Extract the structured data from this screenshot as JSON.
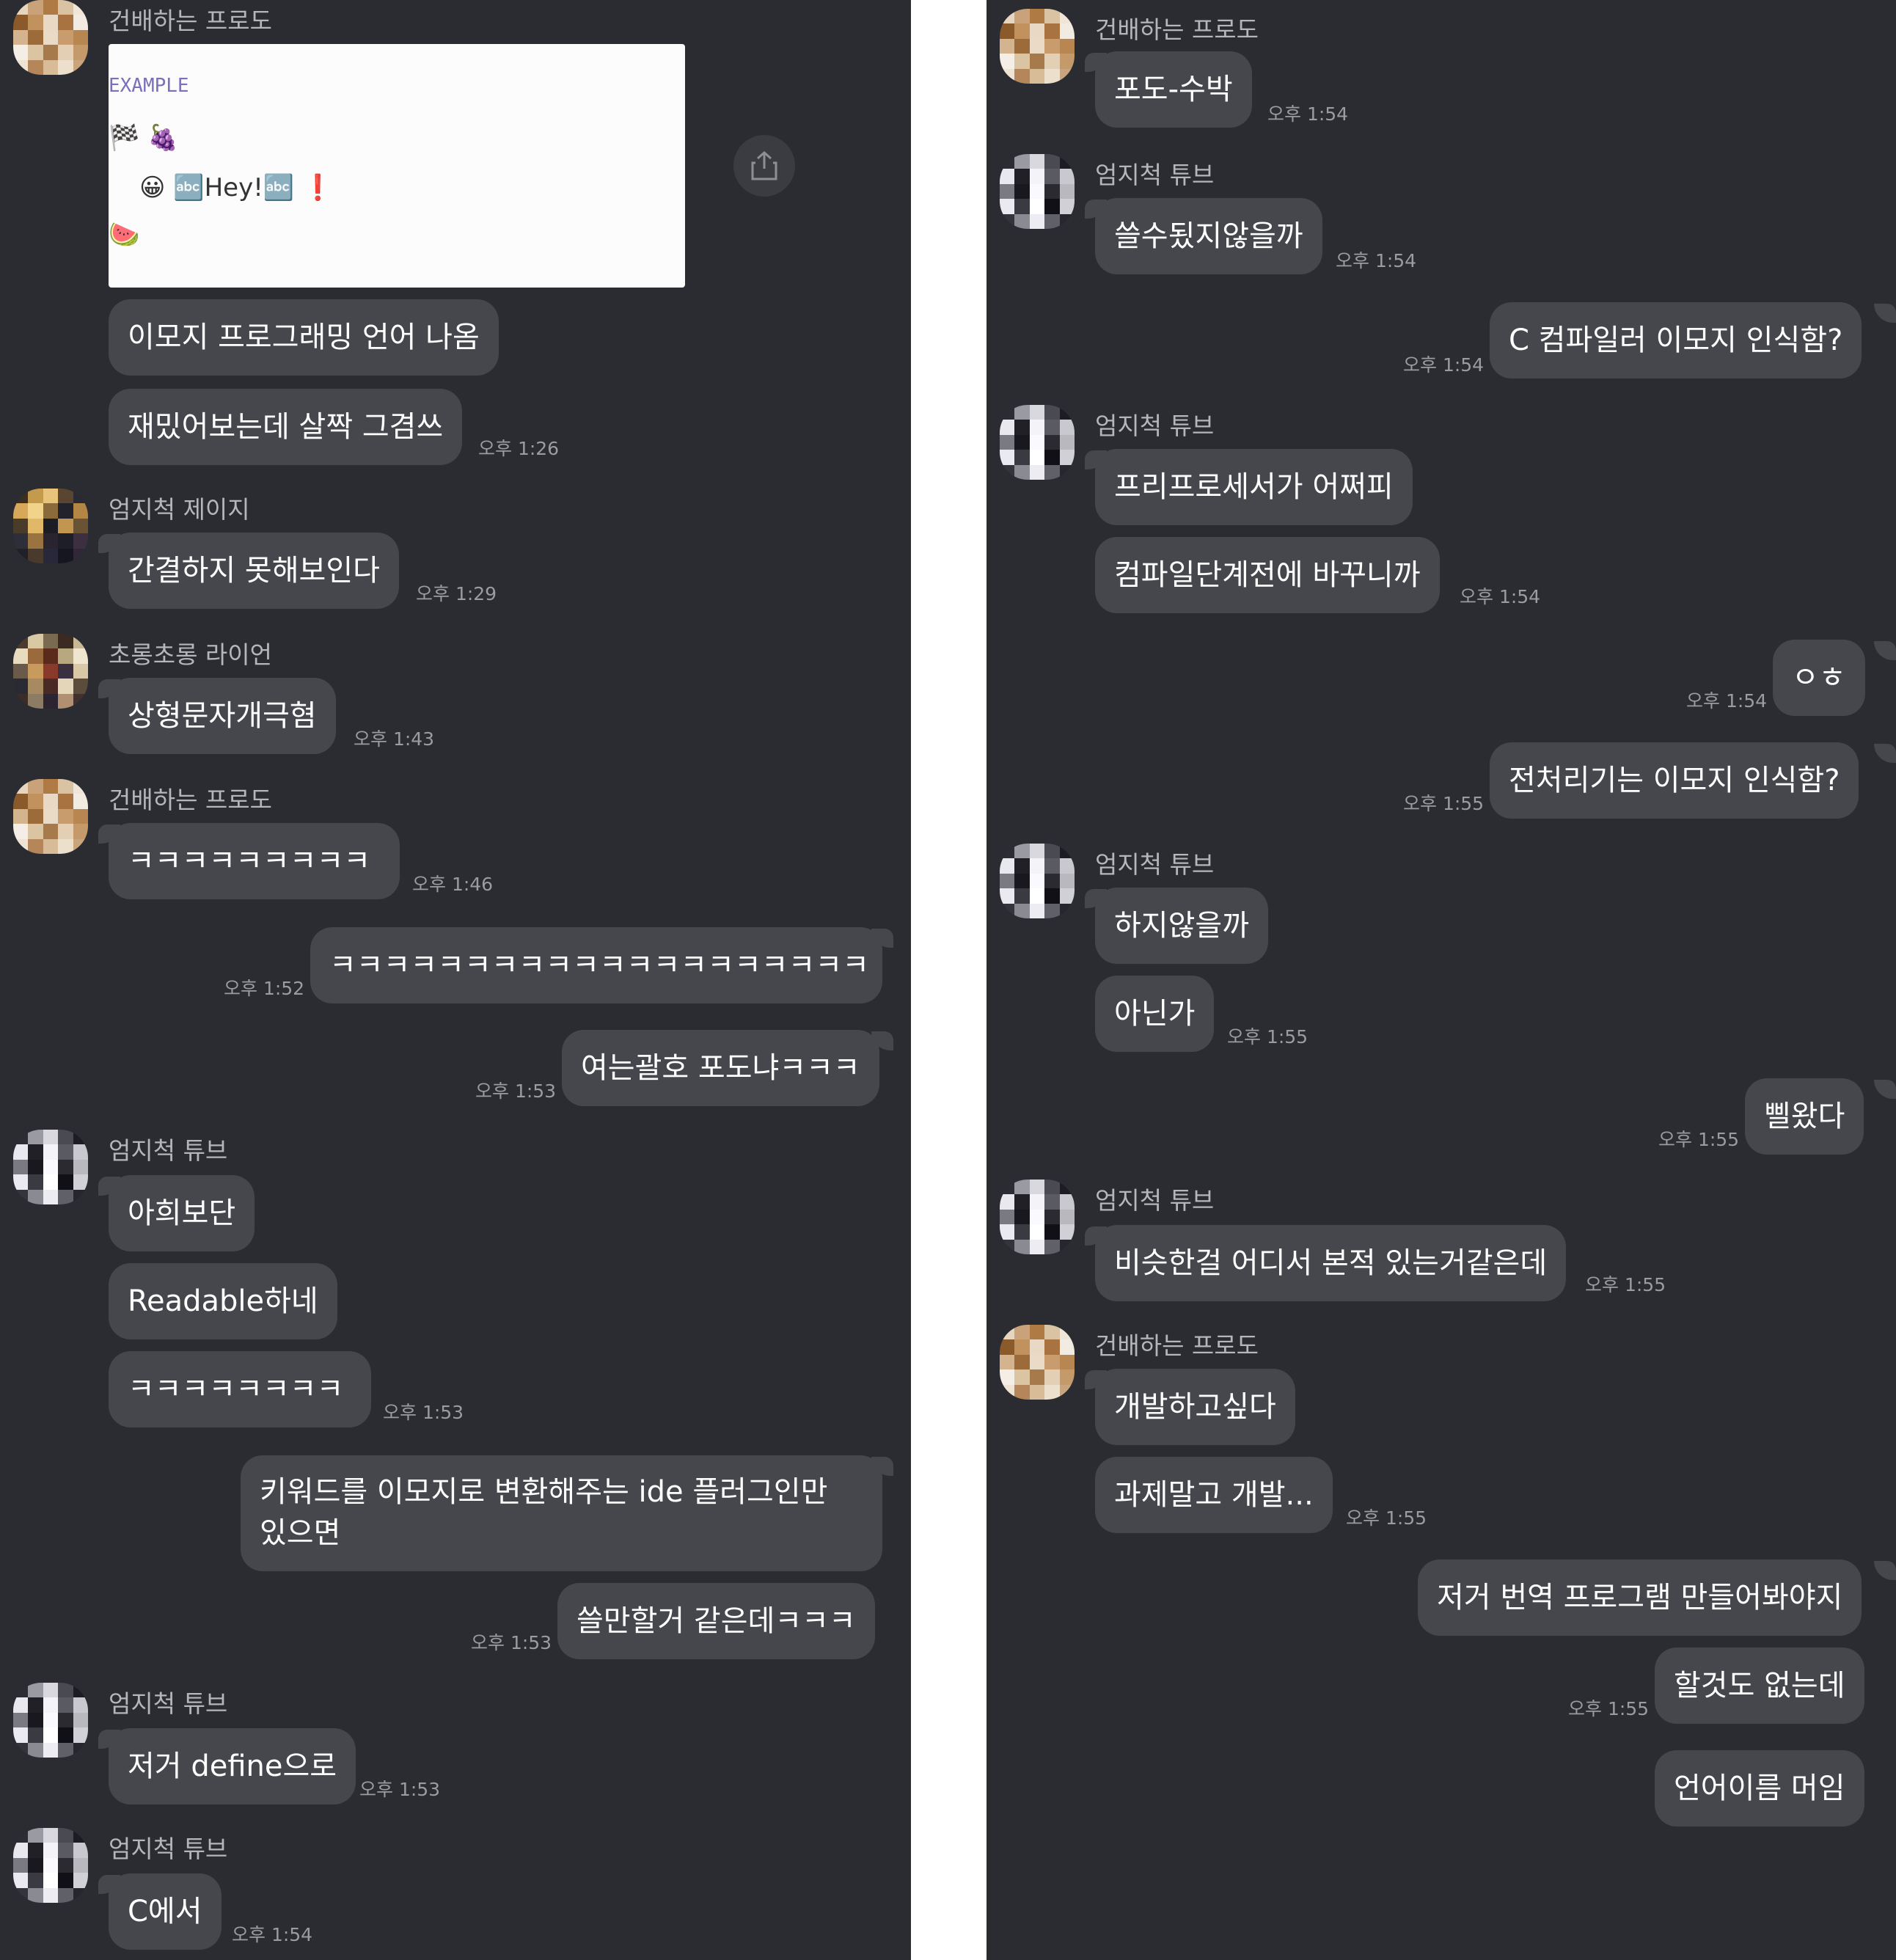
{
  "meta": {
    "ampm": "오후"
  },
  "left": {
    "card": {
      "lines": [
        "EXAMPLE",
        "🏁 🍇",
        "😀 🔤Hey!🔤 ❗",
        "🍉"
      ]
    },
    "messages": [
      {
        "sender": "건배하는 프로도",
        "bubbles": [
          "이모지 프로그래밍 언어 나옴",
          "재밌어보는데 살짝 그겸쓰"
        ],
        "time": "오후 1:26"
      },
      {
        "sender": "엄지척 제이지",
        "bubbles": [
          "간결하지 못해보인다"
        ],
        "time": "오후 1:29"
      },
      {
        "sender": "초롱초롱 라이언",
        "bubbles": [
          "상형문자개극혐"
        ],
        "time": "오후 1:43"
      },
      {
        "sender": "건배하는 프로도",
        "bubbles": [
          "ㅋㅋㅋㅋㅋㅋㅋㅋㅋ"
        ],
        "time": "오후 1:46"
      },
      {
        "mine": true,
        "bubbles": [
          "ㅋㅋㅋㅋㅋㅋㅋㅋㅋㅋㅋㅋㅋㅋㅋㅋㅋㅋㅋㅋ"
        ],
        "time": "오후 1:52"
      },
      {
        "mine": true,
        "bubbles": [
          "여는괄호 포도냐ㅋㅋㅋ"
        ],
        "time": "오후 1:53"
      },
      {
        "sender": "엄지척 튜브",
        "bubbles": [
          "아희보단",
          "Readable하네",
          "ㅋㅋㅋㅋㅋㅋㅋㅋ"
        ],
        "time": "오후 1:53"
      },
      {
        "mine": true,
        "bubbles": [
          "키워드를 이모지로 변환해주는 ide 플러그인만 있으면",
          "쓸만할거 같은데ㅋㅋㅋ"
        ],
        "time": "오후 1:53"
      },
      {
        "sender": "엄지척 튜브",
        "bubbles": [
          "저거 define으로"
        ],
        "time": "오후 1:53"
      },
      {
        "sender": "엄지척 튜브",
        "bubbles": [
          "C에서"
        ],
        "time": "오후 1:54"
      }
    ]
  },
  "right": {
    "messages": [
      {
        "sender": "건배하는 프로도",
        "bubbles": [
          "포도-수박"
        ],
        "time": "오후 1:54"
      },
      {
        "sender": "엄지척 튜브",
        "bubbles": [
          "쓸수됬지않을까"
        ],
        "time": "오후 1:54"
      },
      {
        "mine": true,
        "bubbles": [
          "C 컴파일러 이모지 인식함?"
        ],
        "time": "오후 1:54"
      },
      {
        "sender": "엄지척 튜브",
        "bubbles": [
          "프리프로세서가 어쩌피",
          "컴파일단계전에 바꾸니까"
        ],
        "time": "오후 1:54"
      },
      {
        "mine": true,
        "bubbles": [
          "ㅇㅎ"
        ],
        "time": "오후 1:54"
      },
      {
        "mine": true,
        "bubbles": [
          "전처리기는 이모지 인식함?"
        ],
        "time": "오후 1:55"
      },
      {
        "sender": "엄지척 튜브",
        "bubbles": [
          "하지않을까",
          "아닌가"
        ],
        "time": "오후 1:55"
      },
      {
        "mine": true,
        "bubbles": [
          "삘왔다"
        ],
        "time": "오후 1:55"
      },
      {
        "sender": "엄지척 튜브",
        "bubbles": [
          "비슷한걸 어디서 본적 있는거같은데"
        ],
        "time": "오후 1:55"
      },
      {
        "sender": "건배하는 프로도",
        "bubbles": [
          "개발하고싶다",
          "과제말고 개발..."
        ],
        "time": "오후 1:55"
      },
      {
        "mine": true,
        "bubbles": [
          "저거 번역 프로그램 만들어봐야지",
          "할것도 없는데",
          "언어이름 머임"
        ],
        "time": "오후 1:55"
      }
    ]
  }
}
